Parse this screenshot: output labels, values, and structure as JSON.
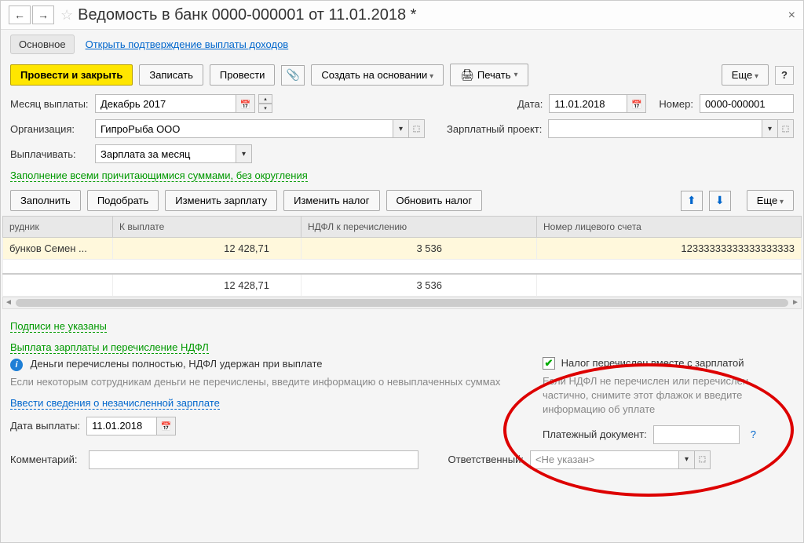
{
  "title": "Ведомость в банк 0000-000001 от 11.01.2018 *",
  "tabs": {
    "main": "Основное",
    "confirm": "Открыть подтверждение выплаты доходов"
  },
  "toolbar": {
    "post_close": "Провести и закрыть",
    "save": "Записать",
    "post": "Провести",
    "create_based": "Создать на основании",
    "print": "Печать",
    "more": "Еще"
  },
  "fields": {
    "month_label": "Месяц выплаты:",
    "month_value": "Декабрь 2017",
    "date_label": "Дата:",
    "date_value": "11.01.2018",
    "number_label": "Номер:",
    "number_value": "0000-000001",
    "org_label": "Организация:",
    "org_value": "ГипроРыба ООО",
    "project_label": "Зарплатный проект:",
    "pay_label": "Выплачивать:",
    "pay_value": "Зарплата за месяц",
    "fill_link": "Заполнение всеми причитающимися суммами, без округления"
  },
  "table_toolbar": {
    "fill": "Заполнить",
    "select": "Подобрать",
    "edit_salary": "Изменить зарплату",
    "edit_tax": "Изменить налог",
    "update_tax": "Обновить налог",
    "more": "Еще"
  },
  "table": {
    "headers": [
      "рудник",
      "К выплате",
      "НДФЛ к перечислению",
      "Номер лицевого счета"
    ],
    "rows": [
      {
        "name": "бунков Семен ...",
        "pay": "12 428,71",
        "ndfl": "3 536",
        "account": "12333333333333333333"
      }
    ],
    "totals": {
      "pay": "12 428,71",
      "ndfl": "3 536"
    }
  },
  "footer": {
    "sign_link": "Подписи не указаны",
    "ndfl_header": "Выплата зарплаты и перечисление НДФЛ",
    "info_text": "Деньги перечислены полностью, НДФЛ удержан при выплате",
    "gray_text": "Если некоторым сотрудникам деньги не перечислены, введите информацию о невыплаченных суммах",
    "unpaid_link": "Ввести сведения о незачисленной зарплате",
    "pay_date_label": "Дата выплаты:",
    "pay_date_value": "11.01.2018",
    "comment_label": "Комментарий:",
    "tax_checkbox": "Налог перечислен вместе с зарплатой",
    "tax_gray": "Если НДФЛ не перечислен или перечислен частично, снимите этот флажок и введите информацию об уплате",
    "pay_doc_label": "Платежный документ:",
    "resp_label": "Ответственный:",
    "resp_value": "<Не указан>"
  }
}
